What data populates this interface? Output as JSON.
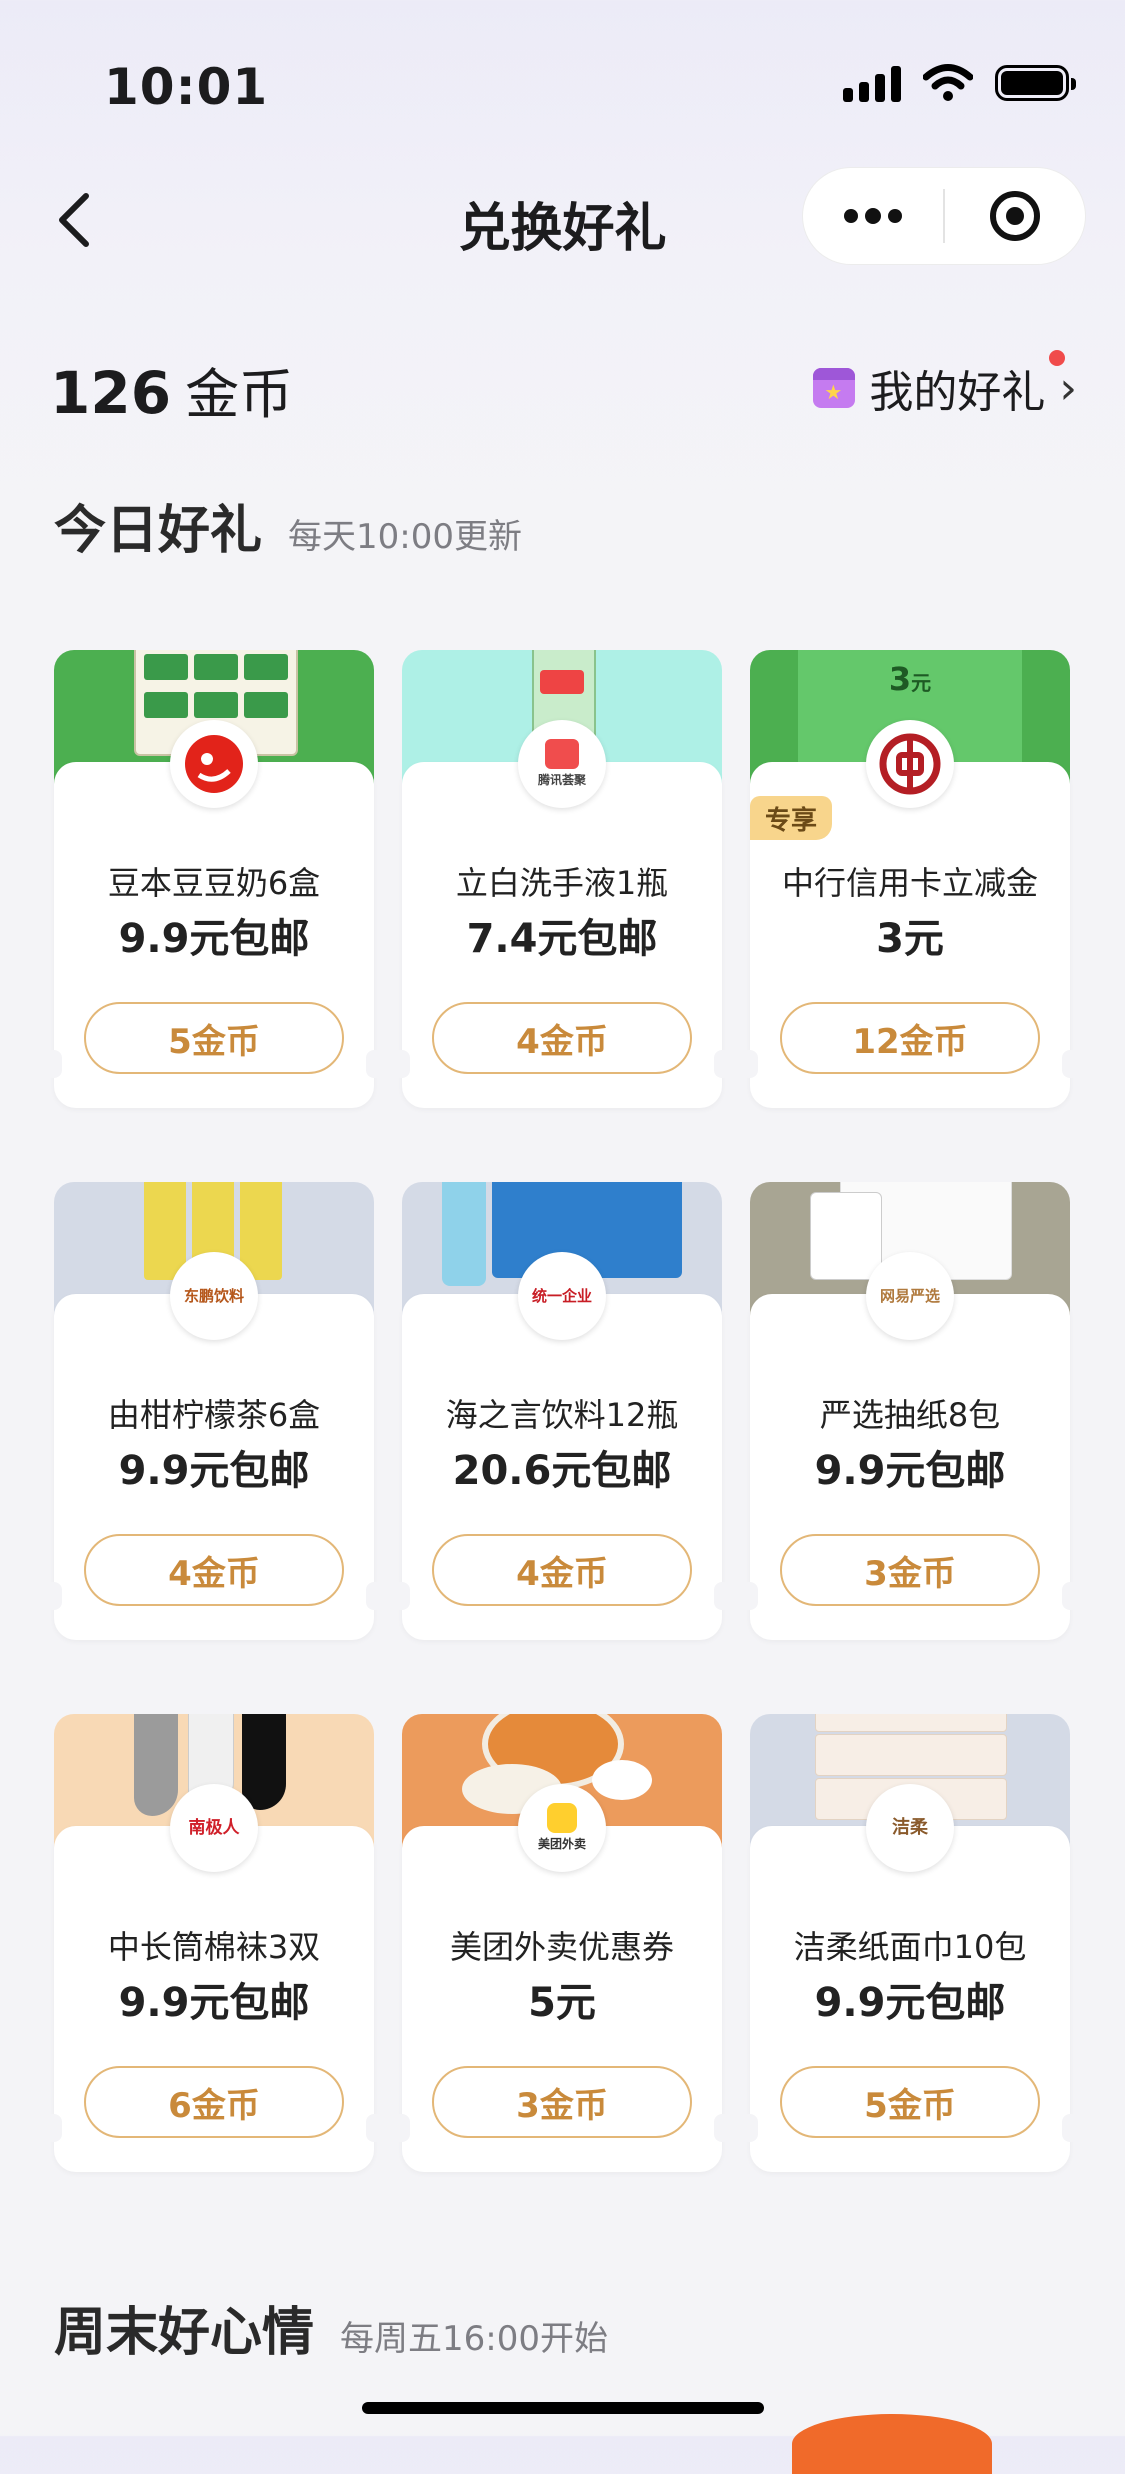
{
  "status_bar": {
    "time": "10:01"
  },
  "nav": {
    "title": "兑换好礼"
  },
  "header": {
    "coin_count": "126",
    "coin_unit": "金币",
    "my_gifts_label": "我的好礼",
    "chevron": "›"
  },
  "today": {
    "title": "今日好礼",
    "subtitle": "每天10:00更新"
  },
  "weekend": {
    "title": "周末好心情",
    "subtitle": "每周五16:00开始"
  },
  "cards": [
    {
      "name": "豆本豆豆奶6盒",
      "price": "9.9元包邮",
      "cost": "5金币",
      "brand": "京东",
      "head_color": "#4caf50"
    },
    {
      "name": "立白洗手液1瓶",
      "price": "7.4元包邮",
      "cost": "4金币",
      "brand": "腾讯荟聚",
      "head_color": "#aef0e6"
    },
    {
      "name": "中行信用卡立减金",
      "price": "3元",
      "cost": "12金币",
      "brand": "中国银行",
      "head_color": "#4caf50",
      "tag": "专享",
      "voucher_amount": "3",
      "voucher_unit": "元"
    },
    {
      "name": "由柑柠檬茶6盒",
      "price": "9.9元包邮",
      "cost": "4金币",
      "brand": "东鹏饮料",
      "head_color": "#d4dae6"
    },
    {
      "name": "海之言饮料12瓶",
      "price": "20.6元包邮",
      "cost": "4金币",
      "brand": "统一企业",
      "head_color": "#d4dae6"
    },
    {
      "name": "严选抽纸8包",
      "price": "9.9元包邮",
      "cost": "3金币",
      "brand": "网易严选",
      "head_color": "#a8a593"
    },
    {
      "name": "中长筒棉袜3双",
      "price": "9.9元包邮",
      "cost": "6金币",
      "brand": "南极人",
      "head_color": "#f8d9b5"
    },
    {
      "name": "美团外卖优惠券",
      "price": "5元",
      "cost": "3金币",
      "brand": "美团外卖",
      "head_color": "#ec9b5c"
    },
    {
      "name": "洁柔纸面巾10包",
      "price": "9.9元包邮",
      "cost": "5金币",
      "brand": "洁柔",
      "head_color": "#d4dae6"
    }
  ],
  "colors": {
    "accent": "#c98a3b",
    "button_border": "#e3b777",
    "red_dot": "#f04b4b"
  }
}
